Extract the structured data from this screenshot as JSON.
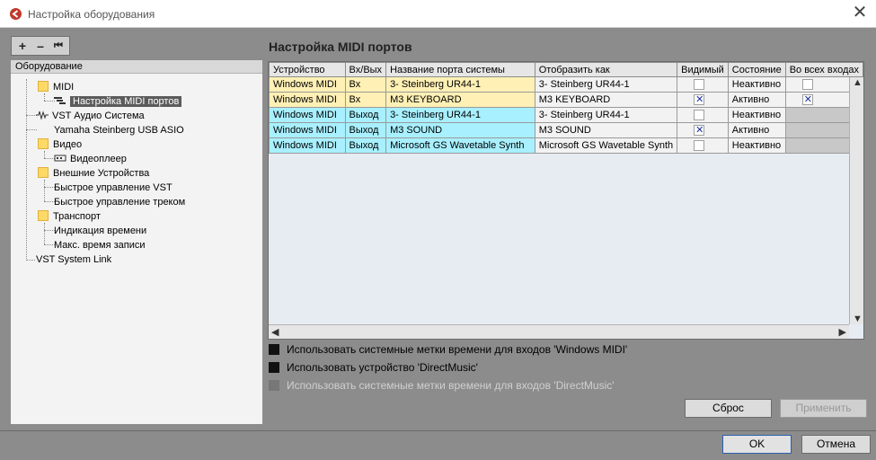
{
  "window": {
    "title": "Настройка оборудования",
    "close_label": "✕"
  },
  "toolbar": {
    "add": "+",
    "remove": "–",
    "reset": "⏮"
  },
  "tree": {
    "header": "Оборудование",
    "items": [
      {
        "label": "MIDI"
      },
      {
        "label": "Настройка MIDI портов"
      },
      {
        "label": "VST Аудио Система"
      },
      {
        "label": "Yamaha Steinberg USB ASIO"
      },
      {
        "label": "Видео"
      },
      {
        "label": "Видеоплеер"
      },
      {
        "label": "Внешние Устройства"
      },
      {
        "label": "Быстрое управление VST"
      },
      {
        "label": "Быстрое управление треком"
      },
      {
        "label": "Транспорт"
      },
      {
        "label": "Индикация времени"
      },
      {
        "label": "Макс. время записи"
      },
      {
        "label": "VST System Link"
      }
    ]
  },
  "main": {
    "title": "Настройка MIDI портов",
    "columns": [
      "Устройство",
      "Вх/Вых",
      "Название порта системы",
      "Отобразить как",
      "Видимый",
      "Состояние",
      "Во всех входах"
    ],
    "rows": [
      {
        "device": "Windows MIDI",
        "dir": "Вх",
        "port": "3- Steinberg UR44-1",
        "display": "3- Steinberg UR44-1",
        "visible": false,
        "state": "Неактивно",
        "all_inputs": false,
        "kind": "in"
      },
      {
        "device": "Windows MIDI",
        "dir": "Вх",
        "port": "M3 KEYBOARD",
        "display": "M3 KEYBOARD",
        "visible": true,
        "state": "Активно",
        "all_inputs": true,
        "kind": "in"
      },
      {
        "device": "Windows MIDI",
        "dir": "Выход",
        "port": "3- Steinberg UR44-1",
        "display": "3- Steinberg UR44-1",
        "visible": false,
        "state": "Неактивно",
        "kind": "out"
      },
      {
        "device": "Windows MIDI",
        "dir": "Выход",
        "port": "M3 SOUND",
        "display": "M3 SOUND",
        "visible": true,
        "state": "Активно",
        "kind": "out"
      },
      {
        "device": "Windows MIDI",
        "dir": "Выход",
        "port": "Microsoft GS Wavetable Synth",
        "display": "Microsoft GS Wavetable Synth",
        "visible": false,
        "state": "Неактивно",
        "kind": "out"
      }
    ],
    "options": [
      {
        "label": "Использовать системные метки времени для входов 'Windows MIDI'",
        "enabled": true
      },
      {
        "label": "Использовать устройство 'DirectMusic'",
        "enabled": true
      },
      {
        "label": "Использовать системные метки времени для входов 'DirectMusic'",
        "enabled": false
      }
    ],
    "reset_label": "Сброс",
    "apply_label": "Применить"
  },
  "footer": {
    "ok_label": "OK",
    "cancel_label": "Отмена"
  },
  "colors": {
    "input_row": "#fff0b5",
    "output_row": "#a8f0ff",
    "accent": "#2b5fad"
  }
}
